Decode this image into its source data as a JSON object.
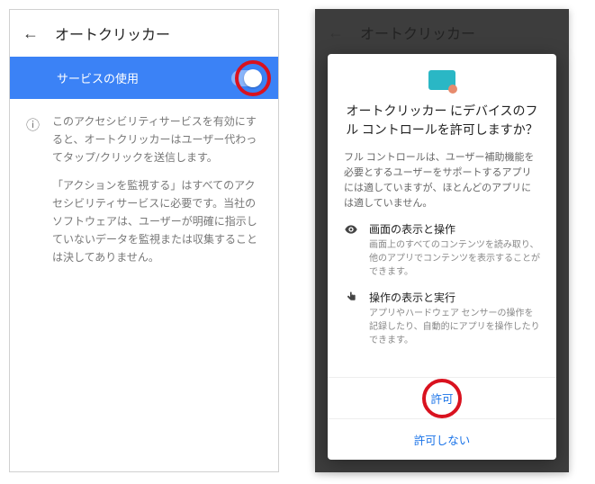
{
  "left": {
    "back_icon": "←",
    "title": "オートクリッカー",
    "service_label": "サービスの使用",
    "info_icon": "ⓘ",
    "info_p1": "このアクセシビリティサービスを有効にすると、オートクリッカーはユーザー代わってタップ/クリックを送信します。",
    "info_p2": "「アクションを監視する」はすべてのアクセシビリティサービスに必要です。当社のソフトウェアは、ユーザーが明確に指示していないデータを監視または収集することは決してありません。"
  },
  "right": {
    "back_icon": "←",
    "title": "オートクリッカー",
    "dialog": {
      "title": "オートクリッカー にデバイスのフル コントロールを許可しますか？",
      "desc": "フル コントロールは、ユーザー補助機能を必要とするユーザーをサポートするアプリには適していますが、ほとんどのアプリには適していません。",
      "perm1_title": "画面の表示と操作",
      "perm1_desc": "画面上のすべてのコンテンツを読み取り、他のアプリでコンテンツを表示することができます。",
      "perm2_title": "操作の表示と実行",
      "perm2_desc": "アプリやハードウェア センサーの操作を記録したり、自動的にアプリを操作したりできます。",
      "allow": "許可",
      "deny": "許可しない"
    }
  }
}
